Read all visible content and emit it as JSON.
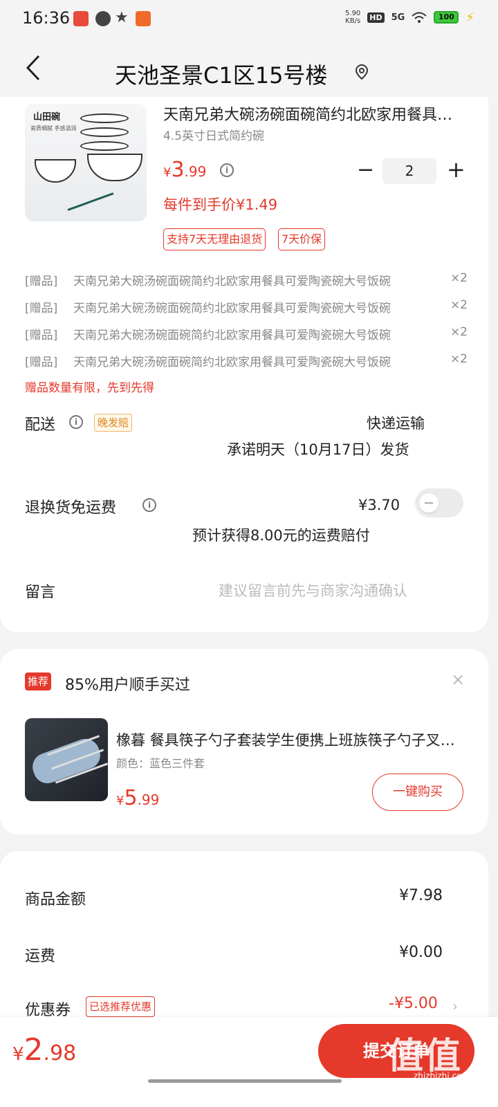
{
  "status_bar": {
    "time": "16:36",
    "net_speed_value": "5.90",
    "net_speed_unit": "KB/s",
    "hd": "HD",
    "signal": "5G",
    "battery": "100"
  },
  "header": {
    "back_icon": "chevron-left-icon",
    "title": "天池圣景C1区15号楼",
    "location_icon": "location-pin-icon"
  },
  "product": {
    "image_label": "山田碗",
    "image_sub": "瓷质细腻 手感温润",
    "title": "天南兄弟大碗汤碗面碗简约北欧家用餐具可爱陶瓷碗大号饭碗",
    "spec": "4.5英寸日式简约碗",
    "price_symbol": "¥",
    "price_int": "3",
    "price_dec": ".99",
    "quantity": "2",
    "minus": "−",
    "plus": "+",
    "per_item_price": "每件到手价¥1.49",
    "tags": [
      "支持7天无理由退货",
      "7天价保"
    ]
  },
  "gifts": [
    {
      "tag": "[赠品]",
      "name": "天南兄弟大碗汤碗面碗简约北欧家用餐具可爱陶瓷碗大号饭碗",
      "qty": "×2"
    },
    {
      "tag": "[赠品]",
      "name": "天南兄弟大碗汤碗面碗简约北欧家用餐具可爱陶瓷碗大号饭碗",
      "qty": "×2"
    },
    {
      "tag": "[赠品]",
      "name": "天南兄弟大碗汤碗面碗简约北欧家用餐具可爱陶瓷碗大号饭碗",
      "qty": "×2"
    },
    {
      "tag": "[赠品]",
      "name": "天南兄弟大碗汤碗面碗简约北欧家用餐具可爱陶瓷碗大号饭碗",
      "qty": "×2"
    }
  ],
  "gift_note": "赠品数量有限，先到先得",
  "delivery": {
    "label": "配送",
    "late_badge": "晚发赔",
    "method": "快递运输",
    "promise": "承诺明天（10月17日）发货"
  },
  "return_shipping": {
    "label": "退换货免运费",
    "price": "¥3.70",
    "note": "预计获得8.00元的运费赔付",
    "toggle_on": false
  },
  "message": {
    "label": "留言",
    "placeholder": "建议留言前先与商家沟通确认"
  },
  "recommend": {
    "badge": "推荐",
    "title": "85%用户顺手买过",
    "close": "×",
    "name": "橡暮 餐具筷子勺子套装学生便携上班族筷子勺子叉子三件套",
    "color": "颜色：蓝色三件套",
    "price_symbol": "¥",
    "price_int": "5",
    "price_dec": ".99",
    "buy_button": "一键购买"
  },
  "summary": {
    "goods_label": "商品金额",
    "goods_value": "¥7.98",
    "shipping_label": "运费",
    "shipping_value": "¥0.00",
    "coupon_label": "优惠券",
    "coupon_tag": "已选推荐优惠",
    "coupon_value": "-¥5.00",
    "chevron": "›"
  },
  "bottom": {
    "total_symbol": "¥",
    "total_int": "2",
    "total_dec": ".98",
    "submit": "提交订单"
  },
  "watermark": {
    "text": "值值值",
    "url": "zhizhizhi.com"
  },
  "colors": {
    "accent": "#e4392b",
    "bg": "#f3f3f3"
  }
}
